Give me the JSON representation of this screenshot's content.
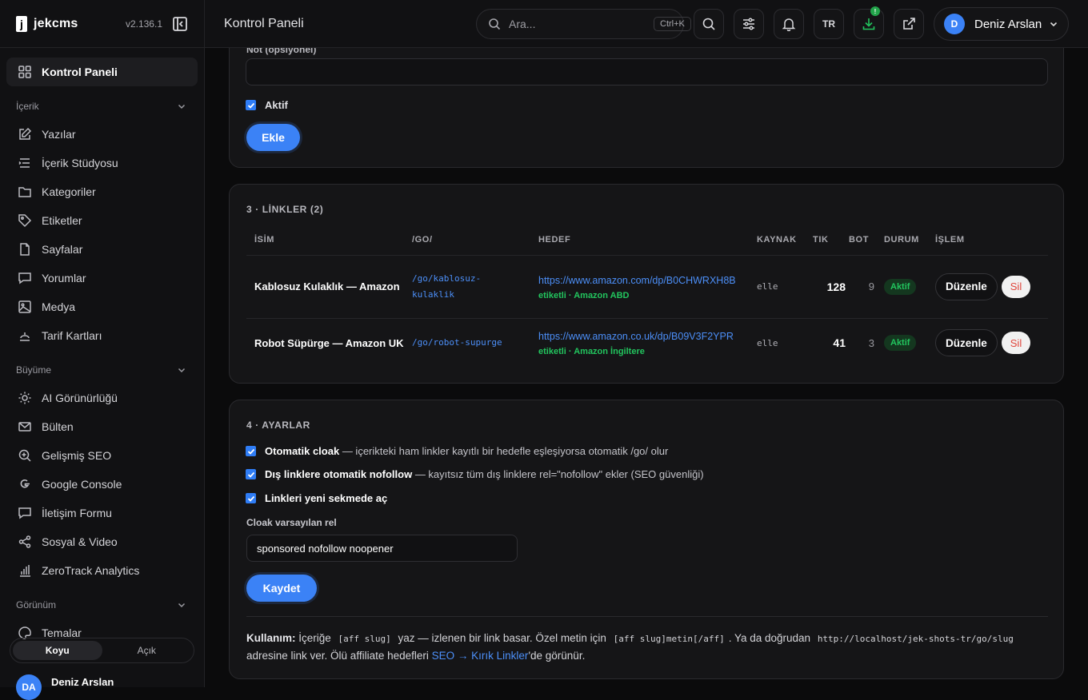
{
  "brand": {
    "name": "jekcms",
    "logo_letter": "j",
    "version": "v2.136.1"
  },
  "nav": {
    "active": "Kontrol Paneli",
    "sections": [
      {
        "title": "İçerik",
        "items": [
          "Yazılar",
          "İçerik Stüdyosu",
          "Kategoriler",
          "Etiketler",
          "Sayfalar",
          "Yorumlar",
          "Medya",
          "Tarif Kartları"
        ]
      },
      {
        "title": "Büyüme",
        "items": [
          "AI Görünürlüğü",
          "Bülten",
          "Gelişmiş SEO",
          "Google Console",
          "İletişim Formu",
          "Sosyal & Video",
          "ZeroTrack Analytics"
        ]
      },
      {
        "title": "Görünüm",
        "items": [
          "Temalar"
        ]
      }
    ]
  },
  "theme": {
    "dark": "Koyu",
    "light": "Açık"
  },
  "sidebar_user": {
    "initials": "DA",
    "name": "Deniz Arslan"
  },
  "topbar": {
    "title": "Kontrol Paneli",
    "search_placeholder": "Ara...",
    "shortcut": "Ctrl+K",
    "lang": "TR",
    "download_badge": "!",
    "user_initial": "D",
    "user_name": "Deniz Arslan"
  },
  "add_form": {
    "note_label": "Not (opsiyonel)",
    "note_value": "",
    "active_label": "Aktif",
    "active_checked": true,
    "submit": "Ekle"
  },
  "links": {
    "title": "3 · LİNKLER (2)",
    "columns": [
      "İSİM",
      "/GO/",
      "HEDEF",
      "KAYNAK",
      "TIK",
      "BOT",
      "DURUM",
      "İŞLEM"
    ],
    "rows": [
      {
        "name": "Kablosuz Kulaklık — Amazon",
        "go": "/go/kablosuz-kulaklik",
        "url": "https://www.amazon.com/dp/B0CHWRXH8B",
        "meta": "etiketli · Amazon ABD",
        "source": "elle",
        "clicks": "128",
        "bots": "9",
        "status": "Aktif",
        "edit": "Düzenle",
        "delete": "Sil"
      },
      {
        "name": "Robot Süpürge — Amazon UK",
        "go": "/go/robot-supurge",
        "url": "https://www.amazon.co.uk/dp/B09V3F2YPR",
        "meta": "etiketli · Amazon İngiltere",
        "source": "elle",
        "clicks": "41",
        "bots": "3",
        "status": "Aktif",
        "edit": "Düzenle",
        "delete": "Sil"
      }
    ]
  },
  "settings": {
    "title": "4 · AYARLAR",
    "options": [
      {
        "label": "Otomatik cloak",
        "desc": " — içerikteki ham linkler kayıtlı bir hedefle eşleşiyorsa otomatik /go/ olur",
        "checked": true
      },
      {
        "label": "Dış linklere otomatik nofollow",
        "desc": " — kayıtsız tüm dış linklere rel=\"nofollow\" ekler (SEO güvenliği)",
        "checked": true
      },
      {
        "label": "Linkleri yeni sekmede aç",
        "desc": "",
        "checked": true
      }
    ],
    "rel_label": "Cloak varsayılan rel",
    "rel_value": "sponsored nofollow noopener",
    "save": "Kaydet",
    "usage": {
      "label": "Kullanım:",
      "t1": " İçeriğe ",
      "code1": "[aff slug]",
      "t2": " yaz — izlenen bir link basar. Özel metin için ",
      "code2": "[aff slug]metin[/aff]",
      "t3": ". Ya da doğrudan ",
      "code3": "http://localhost/jek-shots-tr/go/slug",
      "t4": " adresine link ver. Ölü affiliate hedefleri ",
      "link": "SEO → Kırık Linkler",
      "t5": "'de görünür."
    }
  },
  "colors": {
    "accent": "#3b82f6",
    "success": "#22c55e",
    "danger": "#e0463c",
    "bg": "#0b0b0c",
    "card": "#151517"
  }
}
